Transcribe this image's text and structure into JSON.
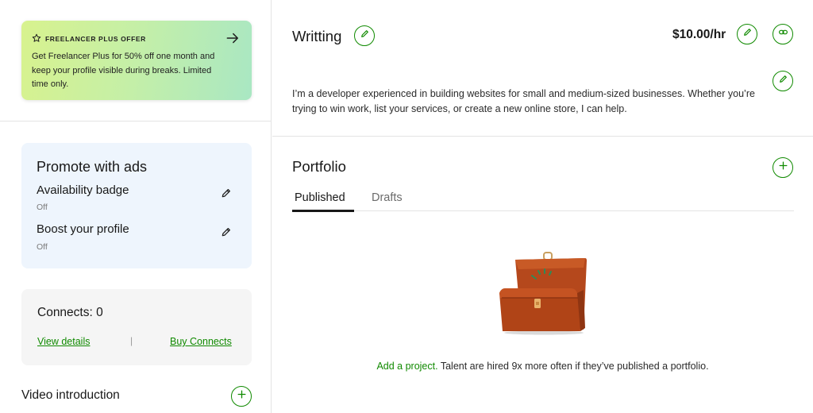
{
  "promo": {
    "tag": "FREELANCER PLUS OFFER",
    "body": "Get Freelancer Plus for 50% off one month and keep your profile visible during breaks. Limited time only.",
    "star_icon": "star-icon",
    "arrow_icon": "arrow-right-icon"
  },
  "ads": {
    "title": "Promote with ads",
    "items": [
      {
        "label": "Availability badge",
        "status": "Off"
      },
      {
        "label": "Boost your profile",
        "status": "Off"
      }
    ]
  },
  "connects": {
    "title": "Connects: 0",
    "view_details": "View details",
    "separator": "|",
    "buy": "Buy Connects"
  },
  "video": {
    "title": "Video introduction"
  },
  "profile": {
    "title": "Writting",
    "rate": "$10.00/hr",
    "overview": "I’m a developer experienced in building websites for small and medium-sized businesses. Whether you’re trying to win work, list your services, or create a new online store, I can help."
  },
  "portfolio": {
    "title": "Portfolio",
    "tabs": [
      {
        "label": "Published",
        "active": true
      },
      {
        "label": "Drafts",
        "active": false
      }
    ],
    "empty_link": "Add a project.",
    "empty_text": " Talent are hired 9x more often if they’ve published a portfolio."
  },
  "colors": {
    "accent": "#108a00",
    "ads_bg": "#eef5fd",
    "connects_bg": "#f5f5f5",
    "briefcase": "#b5481c"
  }
}
